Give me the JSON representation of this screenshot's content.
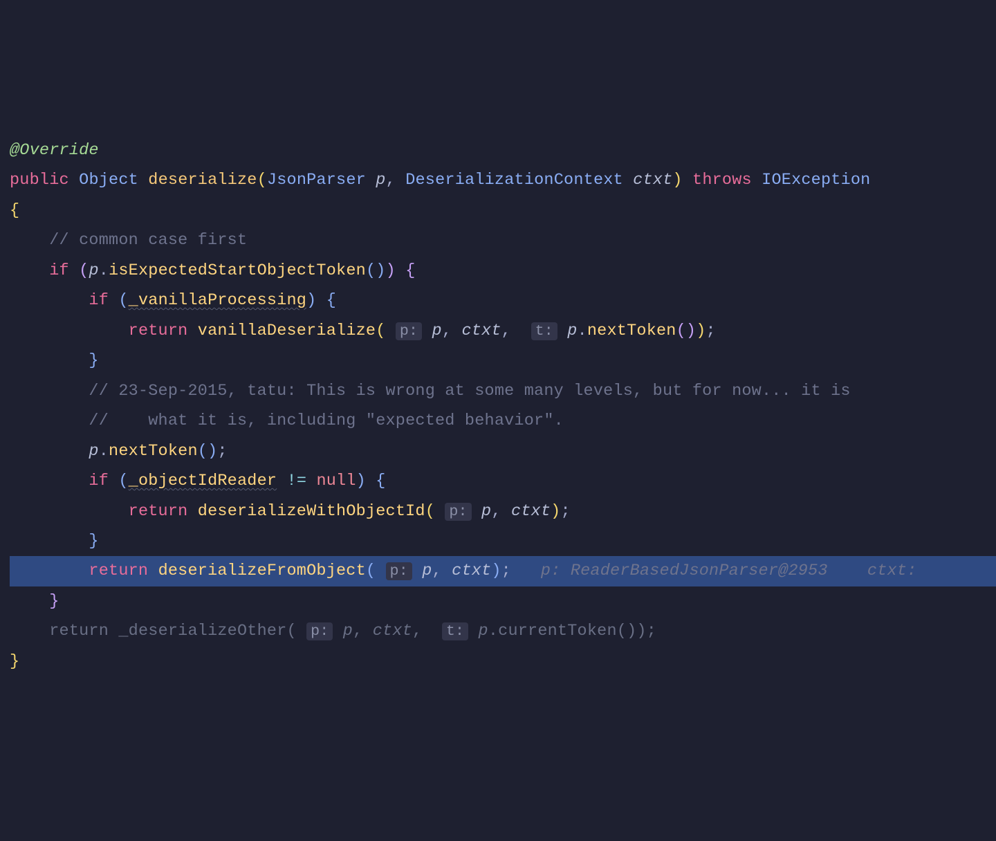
{
  "annotation": "@Override",
  "kw_public": "public",
  "type_object": "Object",
  "method_name": "deserialize",
  "type_jsonparser": "JsonParser",
  "param_p": "p",
  "type_ctx": "DeserializationContext",
  "param_ctxt": "ctxt",
  "kw_throws": "throws",
  "type_ioexception": "IOException",
  "comment1": "// common case first",
  "kw_if": "if",
  "method_isExpected": "isExpectedStartObjectToken",
  "ident_vanilla": "_vanillaProcessing",
  "kw_return": "return",
  "method_vanillaDes": "vanillaDeserialize",
  "hint_p": "p:",
  "hint_t": "t:",
  "method_nextToken": "nextToken",
  "comment2": "// 23-Sep-2015, tatu: This is wrong at some many levels, but for now... it is",
  "comment3": "//    what it is, including \"expected behavior\".",
  "ident_objectIdReader": "_objectIdReader",
  "kw_null": "null",
  "method_desWithObjId": "deserializeWithObjectId",
  "method_desFromObj": "deserializeFromObject",
  "dbg_p": "p: ReaderBasedJsonParser@2953",
  "dbg_ctxt": "ctxt:",
  "method_desOther": "_deserializeOther",
  "method_currentToken": "currentToken",
  "comma": ",",
  "dot": ".",
  "semi": ";",
  "neq": "!=",
  "space": " "
}
